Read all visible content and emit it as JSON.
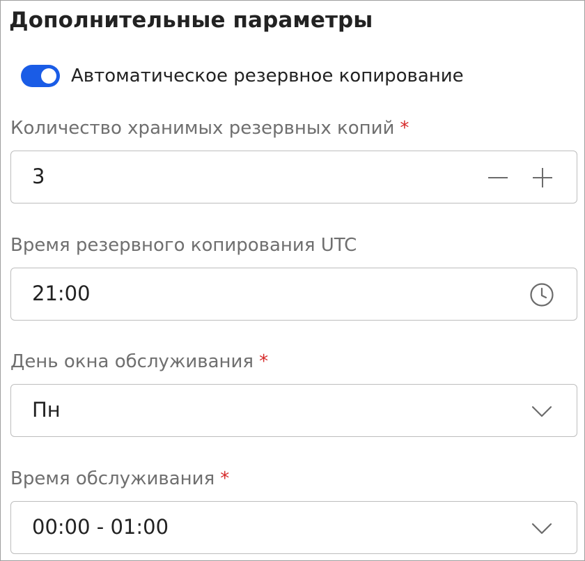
{
  "section": {
    "title": "Дополнительные параметры"
  },
  "auto_backup": {
    "label": "Автоматическое резервное копирование",
    "enabled": true
  },
  "backup_count": {
    "label": "Количество хранимых резервных копий",
    "required_mark": "*",
    "value": "3",
    "decrement_icon": "minus-icon",
    "increment_icon": "plus-icon"
  },
  "backup_time": {
    "label": "Время резервного копирования UTC",
    "value": "21:00",
    "icon": "clock-icon"
  },
  "maintenance_day": {
    "label": "День окна обслуживания",
    "required_mark": "*",
    "value": "Пн",
    "icon": "chevron-down-icon"
  },
  "maintenance_time": {
    "label": "Время обслуживания",
    "required_mark": "*",
    "value": "00:00 - 01:00",
    "icon": "chevron-down-icon"
  },
  "colors": {
    "accent": "#1a5ce6",
    "required": "#d62929",
    "label": "#6f6f6f",
    "border": "#bdbdbd",
    "icon": "#6b6b6b"
  }
}
